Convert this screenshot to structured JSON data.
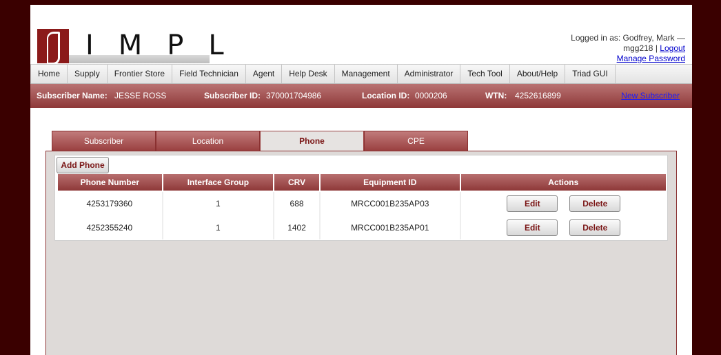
{
  "app": {
    "logo_letters": "IMPL",
    "logo_text": "SIMPL"
  },
  "user": {
    "logged_in_text": "Logged in as: Godfrey, Mark —",
    "username": "mgg218",
    "separator": "|",
    "logout": "Logout",
    "manage_password": "Manage Password"
  },
  "nav": {
    "items": [
      "Home",
      "Supply",
      "Frontier Store",
      "Field Technician",
      "Agent",
      "Help Desk",
      "Management",
      "Administrator",
      "Tech Tool",
      "About/Help",
      "Triad GUI"
    ]
  },
  "subscriber": {
    "name_label": "Subscriber Name:",
    "name_value": "JESSE ROSS",
    "id_label": "Subscriber ID:",
    "id_value": "370001704986",
    "location_label": "Location ID:",
    "location_value": "0000206",
    "wtn_label": "WTN:",
    "wtn_value": "4252616899",
    "new_link": "New Subscriber"
  },
  "tabs": [
    {
      "label": "Subscriber",
      "active": false
    },
    {
      "label": "Location",
      "active": false
    },
    {
      "label": "Phone",
      "active": true
    },
    {
      "label": "CPE",
      "active": false
    }
  ],
  "phone": {
    "add_button": "Add Phone",
    "columns": [
      "Phone Number",
      "Interface Group",
      "CRV",
      "Equipment ID",
      "Actions"
    ],
    "edit_label": "Edit",
    "delete_label": "Delete",
    "rows": [
      {
        "phone": "4253179360",
        "group": "1",
        "crv": "688",
        "equipment": "MRCC001B235AP03"
      },
      {
        "phone": "4252355240",
        "group": "1",
        "crv": "1402",
        "equipment": "MRCC001B235AP01"
      }
    ]
  },
  "colors": {
    "background": "#3a0000",
    "accent": "#8e3838",
    "link": "#0000cc"
  }
}
